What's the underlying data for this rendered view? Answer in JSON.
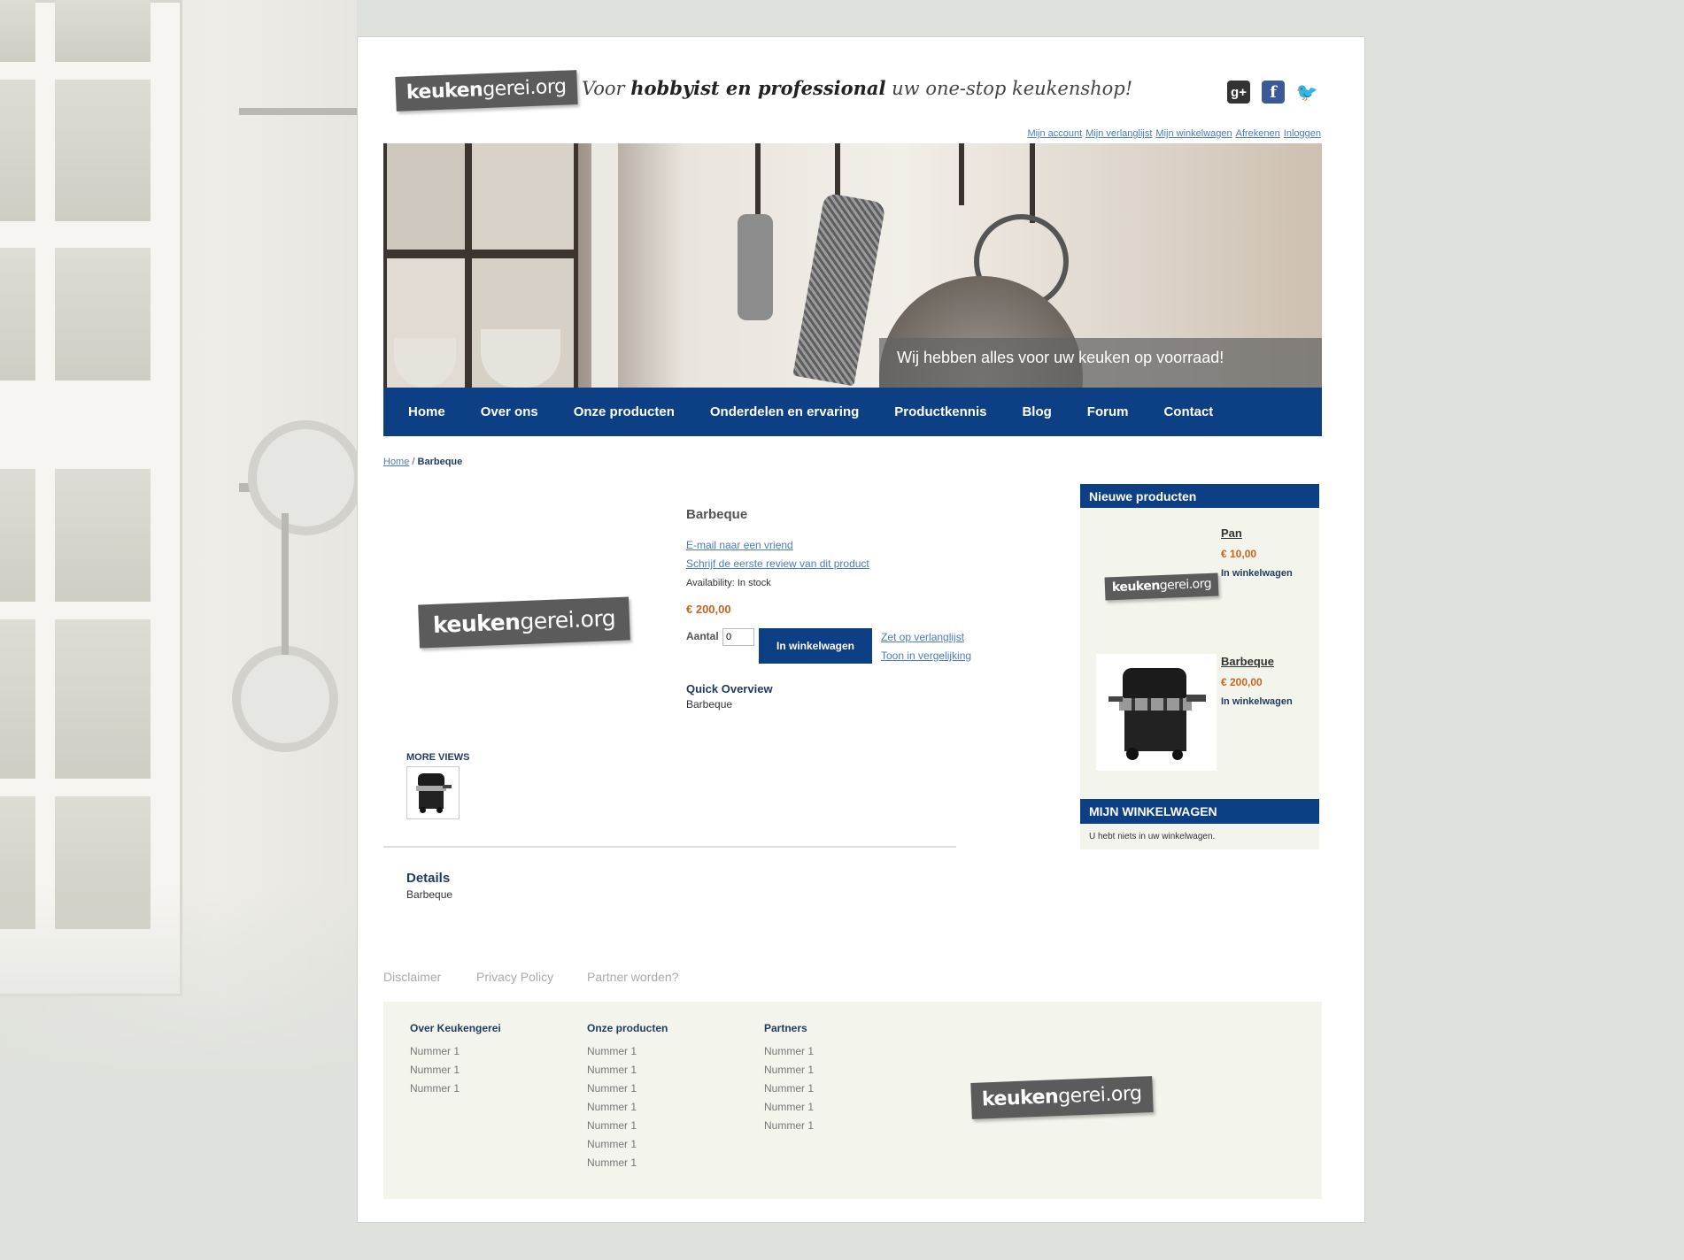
{
  "brand": {
    "logo_main": "keuken",
    "logo_rest": "gerei.org"
  },
  "tagline": {
    "pre": "Voor ",
    "bold": "hobbyist en professional",
    "post": " uw one-stop keukenshop!"
  },
  "social": {
    "google": "g+",
    "facebook": "f",
    "twitter": "🐦"
  },
  "top_links": [
    "Mijn account",
    "Mijn verlanglijst",
    "Mijn winkelwagen",
    "Afrekenen",
    "Inloggen"
  ],
  "banner": {
    "caption": "Wij hebben alles voor uw keuken op voorraad!"
  },
  "nav": [
    "Home",
    "Over ons",
    "Onze producten",
    "Onderdelen en ervaring",
    "Productkennis",
    "Blog",
    "Forum",
    "Contact"
  ],
  "breadcrumb": {
    "home": "Home",
    "sep": " / ",
    "current": "Barbeque"
  },
  "product": {
    "title": "Barbeque",
    "email_link": "E-mail naar een vriend",
    "review_link": "Schrijf de eerste review van dit product",
    "availability": "Availability: In stock",
    "price": "€ 200,00",
    "qty_label": "Aantal",
    "qty_value": "0",
    "add_to_cart": "In winkelwagen",
    "wishlist_link": "Zet op verlanglijst",
    "compare_link": "Toon in vergelijking",
    "quick_overview_title": "Quick Overview",
    "quick_overview_text": "Barbeque",
    "more_views": "MORE VIEWS",
    "details_title": "Details",
    "details_text": "Barbeque"
  },
  "sidebar": {
    "new_products_title": "Nieuwe producten",
    "items": [
      {
        "name": "Pan",
        "price": "€ 10,00",
        "add": "In winkelwagen"
      },
      {
        "name": "Barbeque",
        "price": "€ 200,00",
        "add": "In winkelwagen"
      }
    ],
    "cart_title": "MIJN WINKELWAGEN",
    "cart_empty": "U hebt niets in uw winkelwagen."
  },
  "footer_links": [
    "Disclaimer",
    "Privacy Policy",
    "Partner worden?"
  ],
  "footer": {
    "columns": [
      {
        "title": "Over Keukengerei",
        "items": [
          "Nummer 1",
          "Nummer 1",
          "Nummer 1"
        ]
      },
      {
        "title": "Onze producten",
        "items": [
          "Nummer 1",
          "Nummer 1",
          "Nummer 1",
          "Nummer 1",
          "Nummer 1",
          "Nummer 1",
          "Nummer 1"
        ]
      },
      {
        "title": "Partners",
        "items": [
          "Nummer 1",
          "Nummer 1",
          "Nummer 1",
          "Nummer 1",
          "Nummer 1"
        ]
      }
    ]
  },
  "colors": {
    "nav": "#0d3f84",
    "price": "#c9641f",
    "link": "#4a7cbf",
    "panel": "#f3f4ec"
  }
}
